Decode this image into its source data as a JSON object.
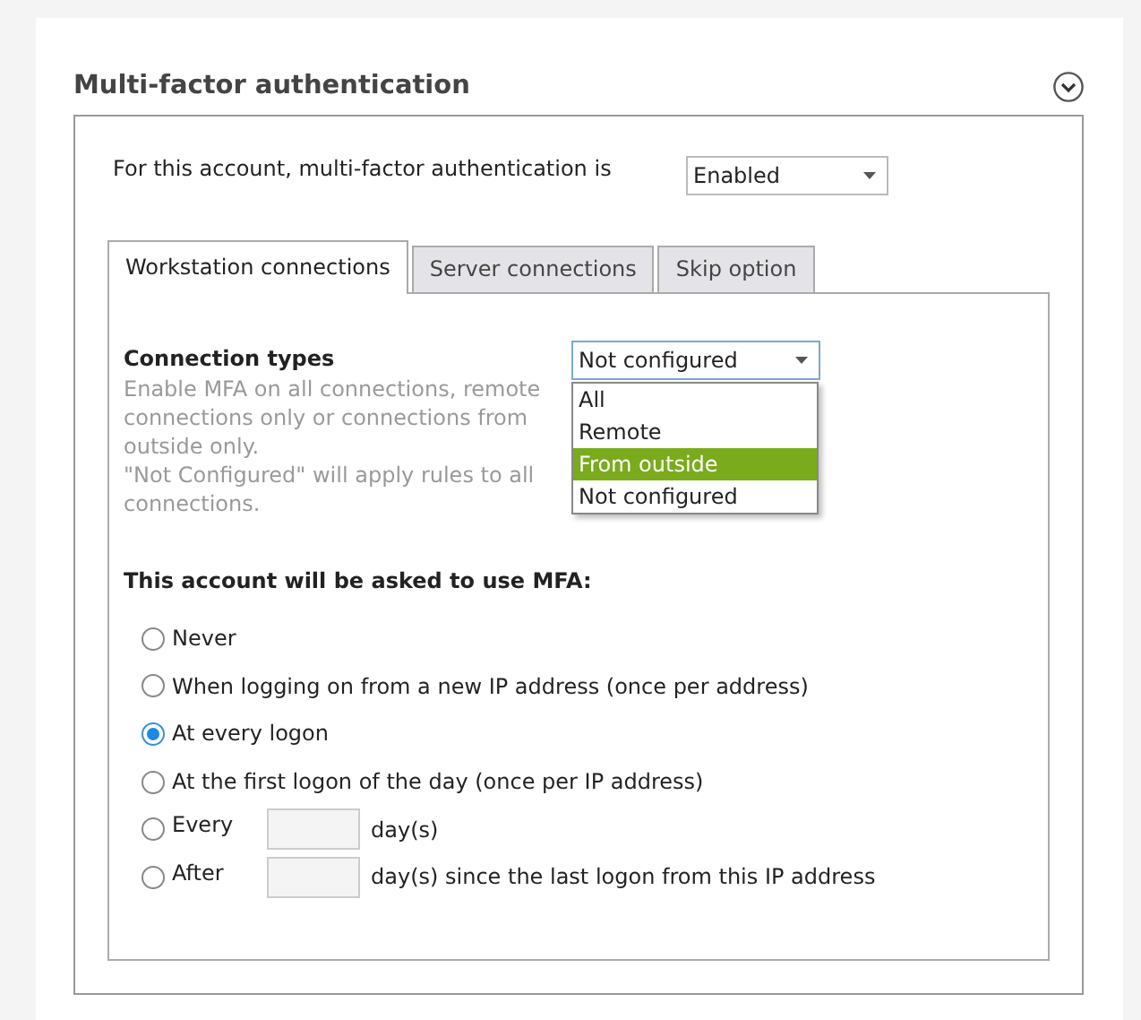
{
  "section": {
    "title": "Multi-factor authentication",
    "expanded": true
  },
  "status": {
    "label": "For this account, multi-factor authentication is",
    "value": "Enabled"
  },
  "tabs": [
    {
      "label": "Workstation connections",
      "selected": true
    },
    {
      "label": "Server connections",
      "selected": false
    },
    {
      "label": "Skip option",
      "selected": false
    }
  ],
  "connection_types": {
    "label": "Connection types",
    "value": "Not configured",
    "expanded": true,
    "description": [
      "Enable MFA on all connections, remote connections only or connections from outside only.",
      "\"Not Configured\" will apply rules to all connections."
    ],
    "options": [
      {
        "label": "All",
        "highlighted": false
      },
      {
        "label": "Remote",
        "highlighted": false
      },
      {
        "label": "From outside",
        "highlighted": true
      },
      {
        "label": "Not configured",
        "highlighted": false
      }
    ]
  },
  "mfa": {
    "heading": "This account will be asked to use MFA:",
    "options": [
      {
        "kind": "plain",
        "label": "Never",
        "selected": false
      },
      {
        "kind": "plain",
        "label": "When logging on from a new IP address (once per address)",
        "selected": false
      },
      {
        "kind": "plain",
        "label": "At every logon",
        "selected": true
      },
      {
        "kind": "plain",
        "label": "At the first logon of the day (once per IP address)",
        "selected": false
      },
      {
        "kind": "days",
        "label": "Every",
        "suffix": "day(s)",
        "selected": false
      },
      {
        "kind": "days",
        "label": "After",
        "suffix": "day(s) since the last logon from this IP address",
        "selected": false
      }
    ]
  }
}
